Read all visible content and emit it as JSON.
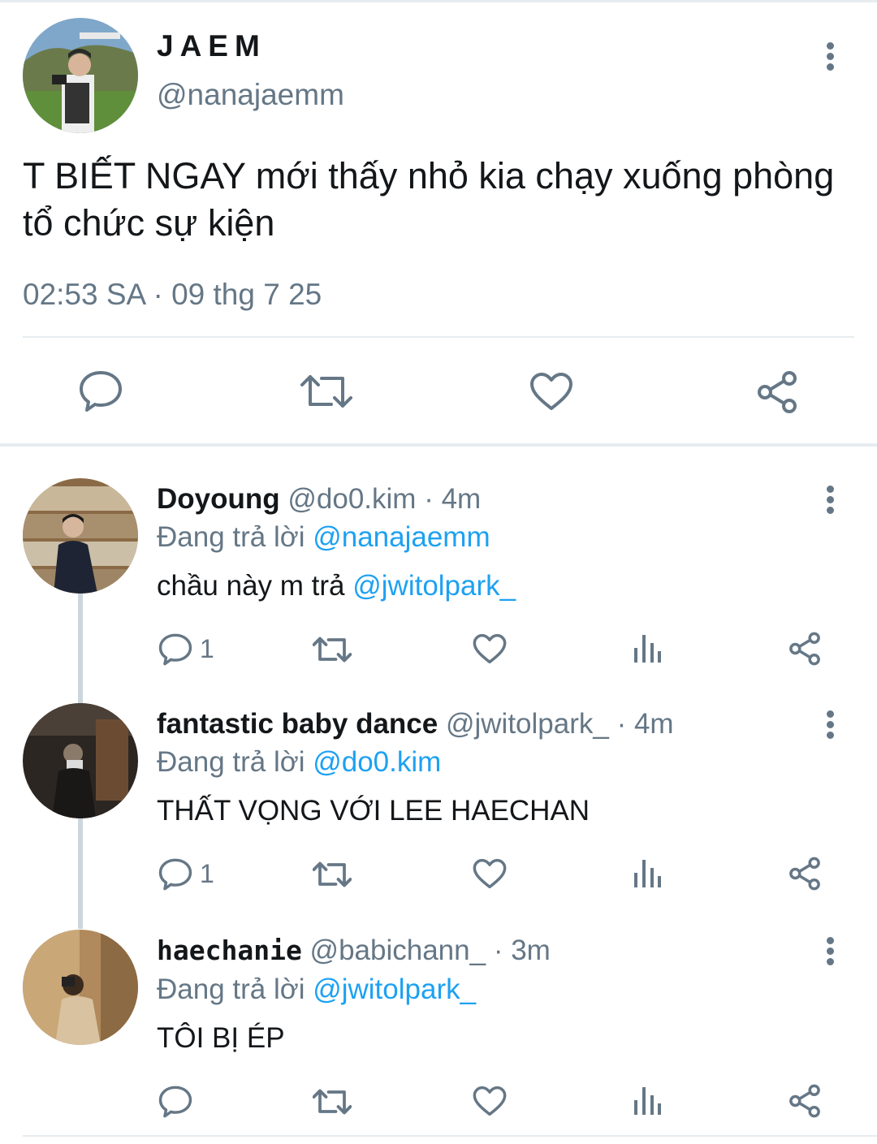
{
  "main_tweet": {
    "display_name": "JAEM",
    "handle": "@nanajaemm",
    "text": "T BIẾT NGAY mới thấy nhỏ kia chạy xuống phòng tổ chức sự kiện",
    "timestamp": "02:53 SA · 09 thg 7 25",
    "actions": [
      "reply-icon",
      "retweet-icon",
      "like-icon",
      "share-icon"
    ]
  },
  "replies": [
    {
      "display_name": "Doyoung",
      "handle": "@do0.kim",
      "time": "· 4m",
      "replying_label": "Đang trả lời",
      "replying_to": "@nanajaemm",
      "text_prefix": "chầu này m trả",
      "text_mention": "@jwitolpark_",
      "reply_count": "1"
    },
    {
      "display_name": "fantastic baby dance",
      "handle": "@jwitolpark_",
      "time": "· 4m",
      "replying_label": "Đang trả lời",
      "replying_to": "@do0.kim",
      "text_prefix": "THẤT VỌNG VỚI LEE HAECHAN",
      "text_mention": "",
      "reply_count": "1"
    },
    {
      "display_name": "haechanie",
      "handle": "@babichann_",
      "time": "· 3m",
      "replying_label": "Đang trả lời",
      "replying_to": "@jwitolpark_",
      "text_prefix": "TÔI BỊ ÉP",
      "text_mention": "",
      "reply_count": ""
    }
  ],
  "colors": {
    "text_primary": "#14171a",
    "text_secondary": "#657786",
    "mention": "#1da1f2",
    "divider": "#e6ecf0"
  }
}
